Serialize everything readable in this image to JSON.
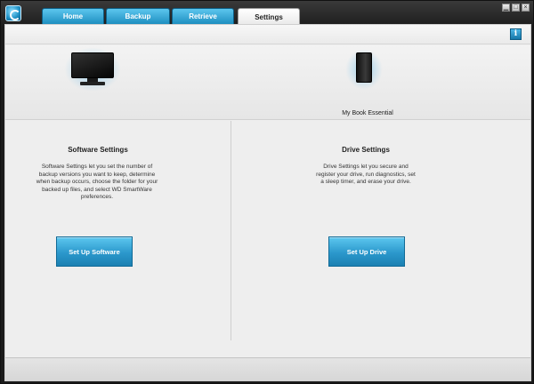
{
  "tabs": [
    {
      "label": "Home"
    },
    {
      "label": "Backup"
    },
    {
      "label": "Retrieve"
    },
    {
      "label": "Settings",
      "active": true
    }
  ],
  "window_controls": {
    "minimize": "▁",
    "restore": "□",
    "close": "×"
  },
  "info_button": {
    "icon": "info-icon",
    "glyph": "i"
  },
  "hero": {
    "computer_icon": "monitor-icon",
    "drive_icon": "external-drive-icon",
    "drive_label": "My Book Essential"
  },
  "software": {
    "title": "Software Settings",
    "description": "Software Settings let you set the number of backup versions you want to keep, determine when backup occurs, choose the folder for your backed up files, and select WD SmartWare preferences.",
    "button": "Set Up Software"
  },
  "drive": {
    "title": "Drive Settings",
    "description": "Drive Settings let you secure and register your drive, run diagnostics, set a sleep timer, and erase your drive.",
    "button": "Set Up Drive"
  },
  "colors": {
    "accent": "#2b98cc",
    "accent_light": "#5cc7ef",
    "frame": "#1b1b1b",
    "content_bg": "#eeeeee"
  }
}
